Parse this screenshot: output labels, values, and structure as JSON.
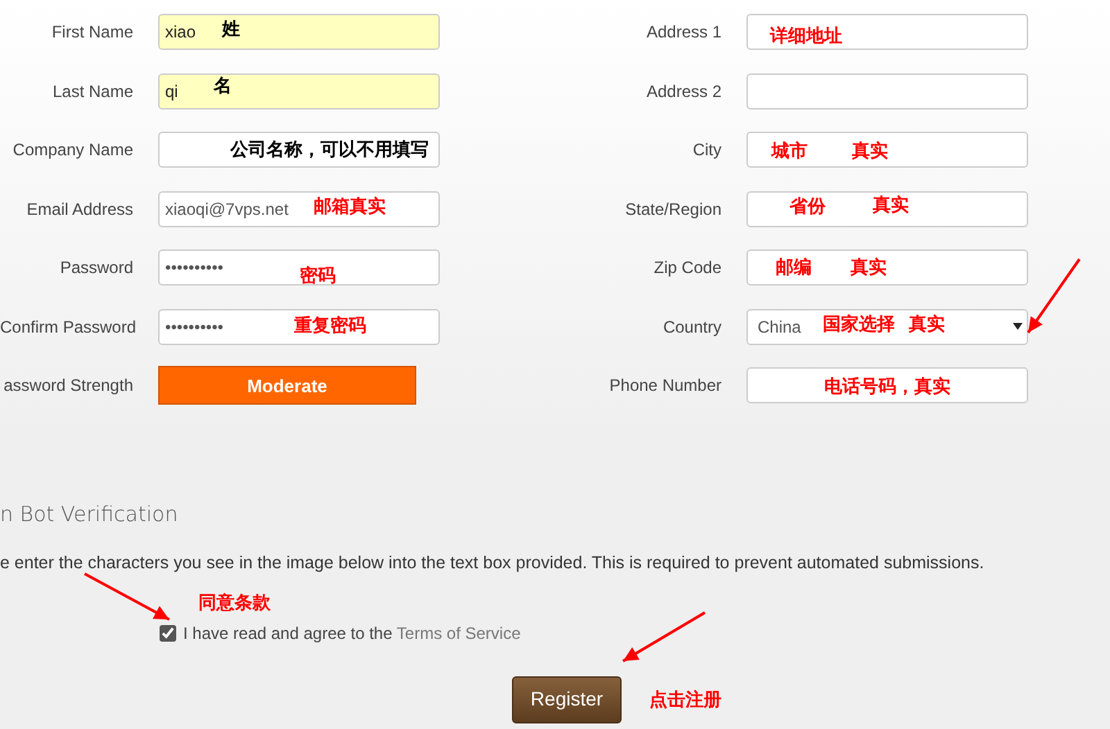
{
  "left_fields": [
    {
      "kind": "text",
      "label": "First Name",
      "value": "xiao",
      "highlighted": true,
      "notes": [
        {
          "text": "姓",
          "color": "#000000"
        }
      ]
    },
    {
      "kind": "text",
      "label": "Last Name",
      "value": "qi",
      "highlighted": true,
      "notes": [
        {
          "text": "名",
          "color": "#000000"
        }
      ]
    },
    {
      "kind": "text",
      "label": "Company Name",
      "highlighted": false,
      "notes": [
        {
          "text": "公司名称，可以不用填写",
          "color": "#000000"
        }
      ]
    },
    {
      "kind": "text",
      "label": "Email Address",
      "value": "xiaoqi@7vps.net",
      "highlighted": false,
      "notes": [
        {
          "text": "邮箱真实",
          "color": "#ff0000"
        }
      ]
    },
    {
      "kind": "text",
      "label": "Password",
      "value": "••••••••••",
      "highlighted": false,
      "notes": [
        {
          "text": "密码",
          "color": "#ff0000"
        }
      ]
    },
    {
      "kind": "text",
      "label": "Confirm Password",
      "value": "••••••••••",
      "highlighted": false,
      "notes": [
        {
          "text": "重复密码",
          "color": "#ff0000"
        }
      ]
    },
    {
      "kind": "meter",
      "label": "assword Strength",
      "value": "Moderate"
    }
  ],
  "right_fields": [
    {
      "kind": "text",
      "label": "Address 1",
      "highlighted": false,
      "notes": [
        {
          "text": "详细地址",
          "color": "#ff0000"
        }
      ]
    },
    {
      "kind": "text",
      "label": "Address 2",
      "highlighted": false
    },
    {
      "kind": "text",
      "label": "City",
      "highlighted": false,
      "notes": [
        {
          "text": "城市",
          "color": "#ff0000"
        },
        {
          "text": "真实",
          "color": "#ff0000"
        }
      ]
    },
    {
      "kind": "text",
      "label": "State/Region",
      "highlighted": false,
      "notes": [
        {
          "text": "省份",
          "color": "#ff0000"
        },
        {
          "text": "真实",
          "color": "#ff0000"
        }
      ]
    },
    {
      "kind": "text",
      "label": "Zip Code",
      "highlighted": false,
      "notes": [
        {
          "text": "邮编",
          "color": "#ff0000"
        },
        {
          "text": "真实",
          "color": "#ff0000"
        }
      ]
    },
    {
      "kind": "select",
      "label": "Country",
      "value": "China",
      "highlighted": false,
      "notes": [
        {
          "text": "国家选择",
          "color": "#ff0000"
        },
        {
          "text": "真实",
          "color": "#ff0000"
        }
      ]
    },
    {
      "kind": "text",
      "label": "Phone Number",
      "highlighted": false,
      "notes": [
        {
          "text": "电话号码，真实",
          "color": "#ff0000"
        }
      ]
    }
  ],
  "verification": {
    "heading": "n Bot Verification",
    "text": "e enter the characters you see in the image below into the text box provided. This is required to prevent automated submissions."
  },
  "agree": {
    "checked": true,
    "text": "I have read and agree to the ",
    "link": "Terms of Service",
    "note": "同意条款"
  },
  "register": {
    "label": "Register",
    "note": "点击注册"
  }
}
